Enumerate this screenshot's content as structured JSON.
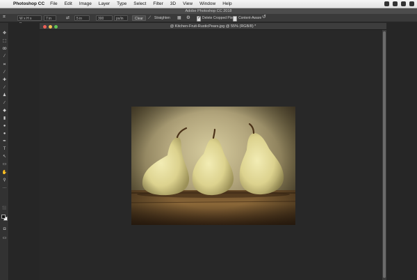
{
  "menubar": {
    "app_name": "Photoshop CC",
    "menus": [
      "File",
      "Edit",
      "Image",
      "Layer",
      "Type",
      "Select",
      "Filter",
      "3D",
      "View",
      "Window",
      "Help"
    ]
  },
  "appbar": {
    "title": "Adobe Photoshop CC 2018"
  },
  "options": {
    "ratio": "W x H x Reso...",
    "width": "7 in",
    "height": "5 in",
    "resolution": "300",
    "units": "px/in",
    "clear_label": "Clear",
    "straighten_label": "Straighten",
    "delete_cropped": {
      "label": "Delete Cropped Pixels",
      "checked": true
    },
    "content_aware": {
      "label": "Content-Aware",
      "checked": false
    }
  },
  "document": {
    "tab_title": "@ Kitchen-Fruit-RusticPears.jpg @ 55% (RGB/8) *"
  },
  "colors": {
    "close": "#ec5f57",
    "minimize": "#f4be4f",
    "maximize": "#62c554"
  }
}
